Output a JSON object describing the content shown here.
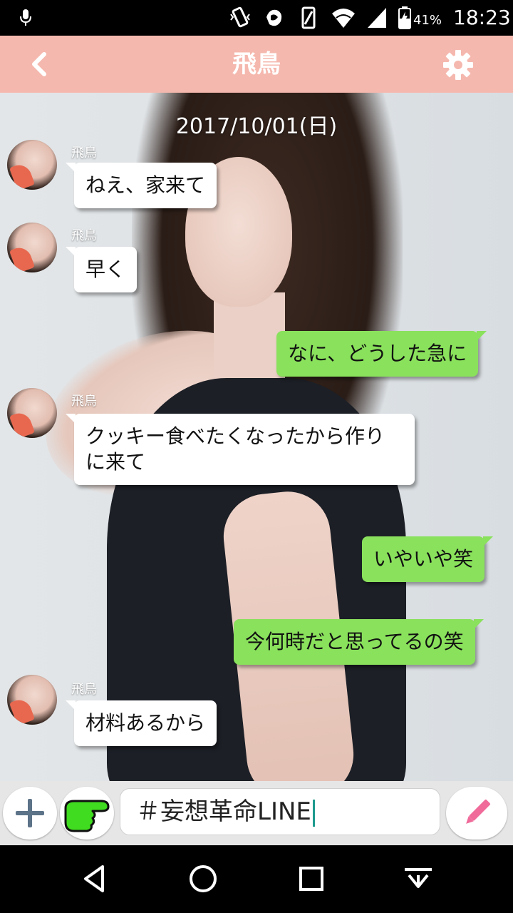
{
  "status_bar": {
    "battery_percent": "41%",
    "time": "18:23",
    "icons": [
      "mic-icon",
      "vibrate-icon",
      "nfc-icon",
      "screen-rotate-icon",
      "wifi-icon",
      "signal-icon",
      "battery-icon"
    ]
  },
  "header": {
    "title": "飛鳥",
    "icons": [
      "back-chevron-icon",
      "gear-icon"
    ],
    "color": "#f5b8ae"
  },
  "chat": {
    "date": "2017/10/01(日)",
    "messages": [
      {
        "side": "in",
        "sender": "飛鳥",
        "text": "ねえ、家来て"
      },
      {
        "side": "in",
        "sender": "飛鳥",
        "text": "早く"
      },
      {
        "side": "out",
        "text": "なに、どうした急に"
      },
      {
        "side": "in",
        "sender": "飛鳥",
        "text": "クッキー食べたくなったから作りに来て"
      },
      {
        "side": "out",
        "text": "いやいや笑"
      },
      {
        "side": "out",
        "text": "今何時だと思ってるの笑"
      },
      {
        "side": "in",
        "sender": "飛鳥",
        "text": "材料あるから"
      }
    ],
    "out_bubble_color": "#8ae15c"
  },
  "input": {
    "value": "＃妄想革命LINE",
    "icons": [
      "plus-icon",
      "pointing-hand-icon",
      "pencil-icon"
    ]
  },
  "nav": {
    "icons": [
      "back-triangle-icon",
      "home-circle-icon",
      "recents-square-icon",
      "keyboard-hide-icon"
    ]
  }
}
